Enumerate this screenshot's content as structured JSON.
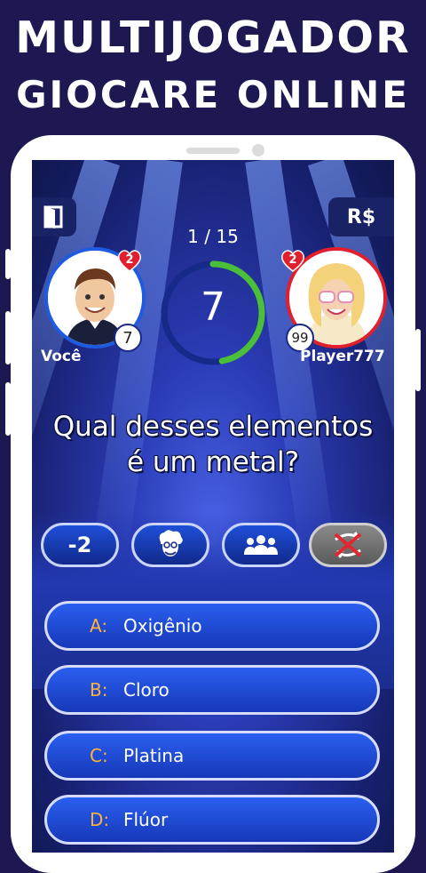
{
  "promo": {
    "line1": "MULTIJOGADOR",
    "line2": "GIOCARE ONLINE"
  },
  "game": {
    "currency_label": "R$",
    "question_counter": "1 / 15",
    "timer_value": "7",
    "timer_fraction": 0.47,
    "question": "Qual desses elementos é um metal?"
  },
  "players": [
    {
      "name": "Você",
      "lives": "2",
      "score": "7"
    },
    {
      "name": "Player777",
      "lives": "2",
      "score": "99"
    }
  ],
  "lifelines": [
    {
      "label": "-2",
      "icon": "minus-two",
      "used": false
    },
    {
      "label": "",
      "icon": "expert-face-icon",
      "used": false
    },
    {
      "label": "",
      "icon": "audience-icon",
      "used": false
    },
    {
      "label": "",
      "icon": "swap-question-icon",
      "used": true
    }
  ],
  "answers": [
    {
      "letter": "A:",
      "text": "Oxigênio"
    },
    {
      "letter": "B:",
      "text": "Cloro"
    },
    {
      "letter": "C:",
      "text": "Platina"
    },
    {
      "letter": "D:",
      "text": "Flúor"
    }
  ],
  "colors": {
    "background": "#1d1752",
    "accent_blue": "#1f5be0",
    "accent_red": "#e11f2d",
    "answer_letter": "#ffb23b",
    "timer_green": "#4bbf3a"
  }
}
